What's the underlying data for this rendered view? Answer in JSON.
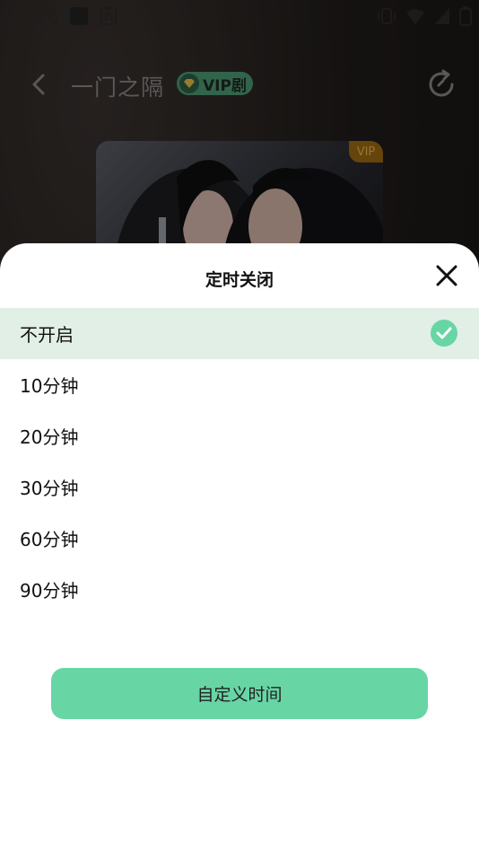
{
  "status_bar": {
    "time": "11:26"
  },
  "header": {
    "title": "一门之隔",
    "vip_badge": "VIP剧"
  },
  "cover": {
    "vip_tag": "VIP"
  },
  "sheet": {
    "title": "定时关闭",
    "options": [
      {
        "label": "不开启",
        "selected": true
      },
      {
        "label": "10分钟",
        "selected": false
      },
      {
        "label": "20分钟",
        "selected": false
      },
      {
        "label": "30分钟",
        "selected": false
      },
      {
        "label": "60分钟",
        "selected": false
      },
      {
        "label": "90分钟",
        "selected": false
      }
    ],
    "custom_button": "自定义时间"
  },
  "colors": {
    "accent": "#68d5a5",
    "selected_row": "#e1efe7",
    "check": "#68d5a5",
    "vip_badge": "#4e9a73"
  }
}
